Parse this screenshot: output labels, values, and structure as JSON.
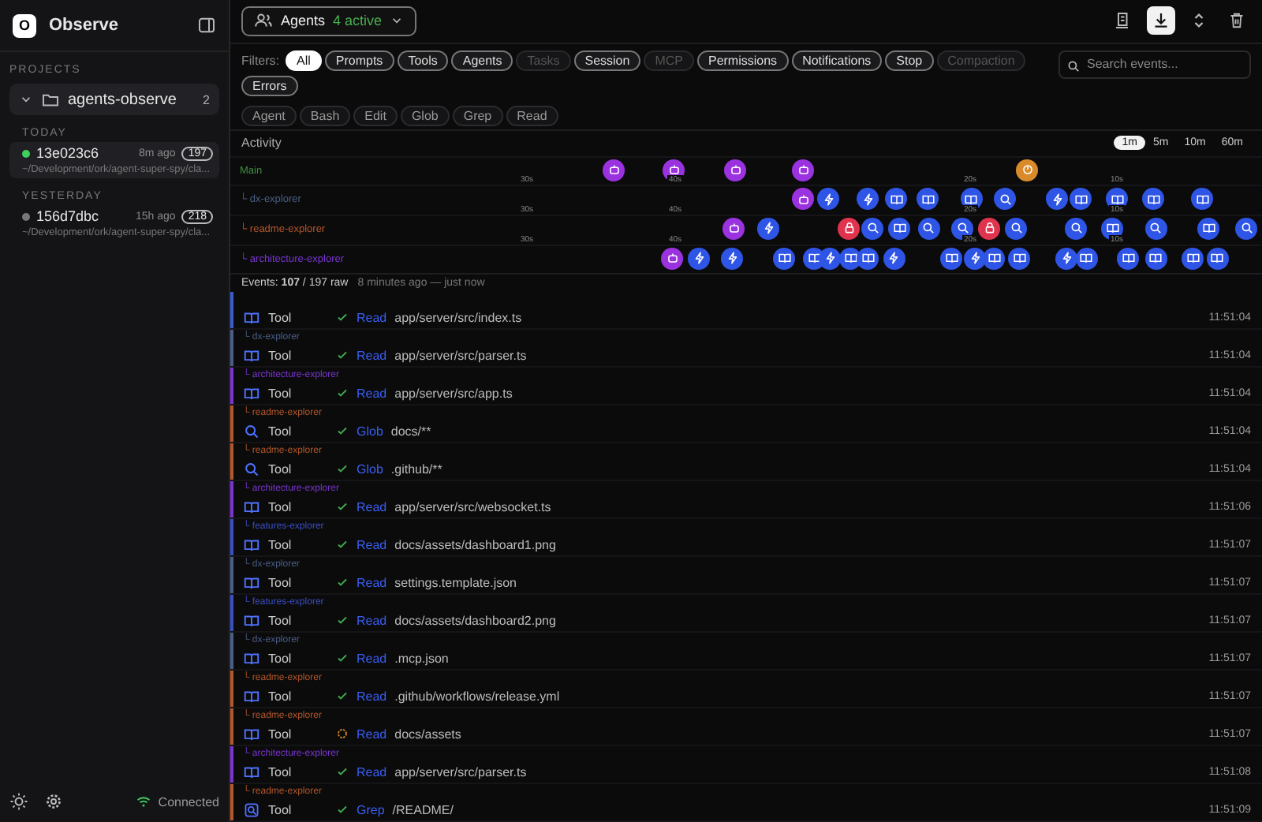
{
  "sidebar": {
    "logo": "O",
    "title": "Observe",
    "section": "PROJECTS",
    "project": {
      "name": "agents-observe",
      "count": "2",
      "expanded": true
    },
    "groups": [
      {
        "label": "TODAY",
        "sessions": [
          {
            "id": "13e023c6",
            "age": "8m ago",
            "count": "197",
            "path": "~/Development/ork/agent-super-spy/cla...",
            "selected": true,
            "live": true
          }
        ]
      },
      {
        "label": "YESTERDAY",
        "sessions": [
          {
            "id": "156d7dbc",
            "age": "15h ago",
            "count": "218",
            "path": "~/Development/ork/agent-super-spy/cla...",
            "selected": false,
            "live": false
          }
        ]
      }
    ],
    "status": "Connected"
  },
  "header": {
    "agents_label": "Agents",
    "active": "4 active"
  },
  "filters": {
    "label": "Filters:",
    "chips": [
      {
        "label": "All",
        "selected": true,
        "disabled": false
      },
      {
        "label": "Prompts",
        "selected": false,
        "disabled": false
      },
      {
        "label": "Tools",
        "selected": false,
        "disabled": false
      },
      {
        "label": "Agents",
        "selected": false,
        "disabled": false
      },
      {
        "label": "Tasks",
        "selected": false,
        "disabled": true
      },
      {
        "label": "Session",
        "selected": false,
        "disabled": false
      },
      {
        "label": "MCP",
        "selected": false,
        "disabled": true
      },
      {
        "label": "Permissions",
        "selected": false,
        "disabled": false
      },
      {
        "label": "Notifications",
        "selected": false,
        "disabled": false
      },
      {
        "label": "Stop",
        "selected": false,
        "disabled": false
      },
      {
        "label": "Compaction",
        "selected": false,
        "disabled": true
      },
      {
        "label": "Errors",
        "selected": false,
        "disabled": false
      }
    ],
    "tools": [
      "Agent",
      "Bash",
      "Edit",
      "Glob",
      "Grep",
      "Read"
    ],
    "search": {
      "placeholder": "Search events..."
    }
  },
  "activity": {
    "title": "Activity",
    "ranges": [
      {
        "label": "1m",
        "selected": true
      },
      {
        "label": "5m",
        "selected": false
      },
      {
        "label": "10m",
        "selected": false
      },
      {
        "label": "60m",
        "selected": false
      }
    ],
    "lanes": [
      {
        "label": "Main",
        "color": "#3f8f3a",
        "ticks": [
          "30s",
          "40s",
          "20s",
          "10s"
        ],
        "events": [
          {
            "kind": "agent"
          },
          {
            "kind": "agent"
          },
          {
            "kind": "agent"
          },
          {
            "kind": "agent"
          },
          {
            "kind": "stop"
          }
        ]
      },
      {
        "label": "└ dx-explorer",
        "color": "#4a5f86",
        "ticks": [
          "30s",
          "40s",
          "20s",
          "10s"
        ],
        "events": [
          {
            "kind": "agent"
          },
          {
            "kind": "bolt"
          },
          {
            "kind": "bolt"
          },
          {
            "kind": "read"
          },
          {
            "kind": "read"
          },
          {
            "kind": "read"
          },
          {
            "kind": "search"
          },
          {
            "kind": "bolt"
          },
          {
            "kind": "read"
          },
          {
            "kind": "read"
          },
          {
            "kind": "read"
          },
          {
            "kind": "read"
          }
        ]
      },
      {
        "label": "└ readme-explorer",
        "color": "#b4572a",
        "ticks": [
          "30s",
          "40s",
          "20s",
          "10s"
        ],
        "events": [
          {
            "kind": "agent"
          },
          {
            "kind": "bolt"
          },
          {
            "kind": "lock"
          },
          {
            "kind": "search"
          },
          {
            "kind": "read"
          },
          {
            "kind": "search"
          },
          {
            "kind": "search"
          },
          {
            "kind": "lock"
          },
          {
            "kind": "search"
          },
          {
            "kind": "search"
          },
          {
            "kind": "read"
          },
          {
            "kind": "search"
          },
          {
            "kind": "read"
          },
          {
            "kind": "search"
          }
        ]
      },
      {
        "label": "└ architecture-explorer",
        "color": "#7a35d0",
        "events": [
          {
            "kind": "agent"
          },
          {
            "kind": "bolt"
          },
          {
            "kind": "bolt"
          },
          {
            "kind": "read"
          },
          {
            "kind": "read"
          },
          {
            "kind": "bolt"
          },
          {
            "kind": "read"
          },
          {
            "kind": "read"
          },
          {
            "kind": "bolt"
          },
          {
            "kind": "read"
          },
          {
            "kind": "bolt"
          },
          {
            "kind": "read"
          },
          {
            "kind": "read"
          },
          {
            "kind": "bolt"
          },
          {
            "kind": "read"
          },
          {
            "kind": "read"
          },
          {
            "kind": "read"
          },
          {
            "kind": "read"
          },
          {
            "kind": "read"
          }
        ]
      }
    ]
  },
  "summary": {
    "counts": "Events: **107** / 197 raw",
    "range": "8 minutes ago — just now"
  },
  "events": [
    {
      "color": "#3b5bd0",
      "kind": "read",
      "label": "Tool",
      "complete": true,
      "tool": "Read",
      "target": "app/server/src/index.ts",
      "time": "11:51:04"
    },
    {
      "agent": "└ dx-explorer",
      "color": "#4a5f86",
      "kind": "read",
      "label": "Tool",
      "complete": true,
      "tool": "Read",
      "target": "app/server/src/parser.ts",
      "time": "11:51:04"
    },
    {
      "agent": "└ architecture-explorer",
      "color": "#7a35d0",
      "kind": "read",
      "label": "Tool",
      "complete": true,
      "tool": "Read",
      "target": "app/server/src/app.ts",
      "time": "11:51:04"
    },
    {
      "agent": "└ readme-explorer",
      "color": "#b4572a",
      "kind": "glob",
      "label": "Tool",
      "complete": true,
      "tool": "Glob",
      "target": "docs/**",
      "time": "11:51:04"
    },
    {
      "agent": "└ readme-explorer",
      "color": "#b4572a",
      "kind": "glob",
      "label": "Tool",
      "complete": true,
      "tool": "Glob",
      "target": ".github/**",
      "time": "11:51:04"
    },
    {
      "agent": "└ architecture-explorer",
      "color": "#7a35d0",
      "kind": "read",
      "label": "Tool",
      "complete": true,
      "tool": "Read",
      "target": "app/server/src/websocket.ts",
      "time": "11:51:06"
    },
    {
      "agent": "└ features-explorer",
      "color": "#3b4fc4",
      "kind": "read",
      "label": "Tool",
      "complete": true,
      "tool": "Read",
      "target": "docs/assets/dashboard1.png",
      "time": "11:51:07"
    },
    {
      "agent": "└ dx-explorer",
      "color": "#4a5f86",
      "kind": "read",
      "label": "Tool",
      "complete": true,
      "tool": "Read",
      "target": "settings.template.json",
      "time": "11:51:07"
    },
    {
      "agent": "└ features-explorer",
      "color": "#3b4fc4",
      "kind": "read",
      "label": "Tool",
      "complete": true,
      "tool": "Read",
      "target": "docs/assets/dashboard2.png",
      "time": "11:51:07"
    },
    {
      "agent": "└ dx-explorer",
      "color": "#4a5f86",
      "kind": "read",
      "label": "Tool",
      "complete": true,
      "tool": "Read",
      "target": ".mcp.json",
      "time": "11:51:07"
    },
    {
      "agent": "└ readme-explorer",
      "color": "#b4572a",
      "kind": "read",
      "label": "Tool",
      "complete": true,
      "tool": "Read",
      "target": ".github/workflows/release.yml",
      "time": "11:51:07"
    },
    {
      "agent": "└ readme-explorer",
      "color": "#b4572a",
      "kind": "read",
      "label": "Tool",
      "complete": false,
      "tool": "Read",
      "target": "docs/assets",
      "time": "11:51:07"
    },
    {
      "agent": "└ architecture-explorer",
      "color": "#7a35d0",
      "kind": "read",
      "label": "Tool",
      "complete": true,
      "tool": "Read",
      "target": "app/server/src/parser.ts",
      "time": "11:51:08"
    },
    {
      "agent": "└ readme-explorer",
      "color": "#b4572a",
      "kind": "grep",
      "label": "Tool",
      "complete": true,
      "tool": "Grep",
      "target": "/README/",
      "time": "11:51:09"
    }
  ]
}
